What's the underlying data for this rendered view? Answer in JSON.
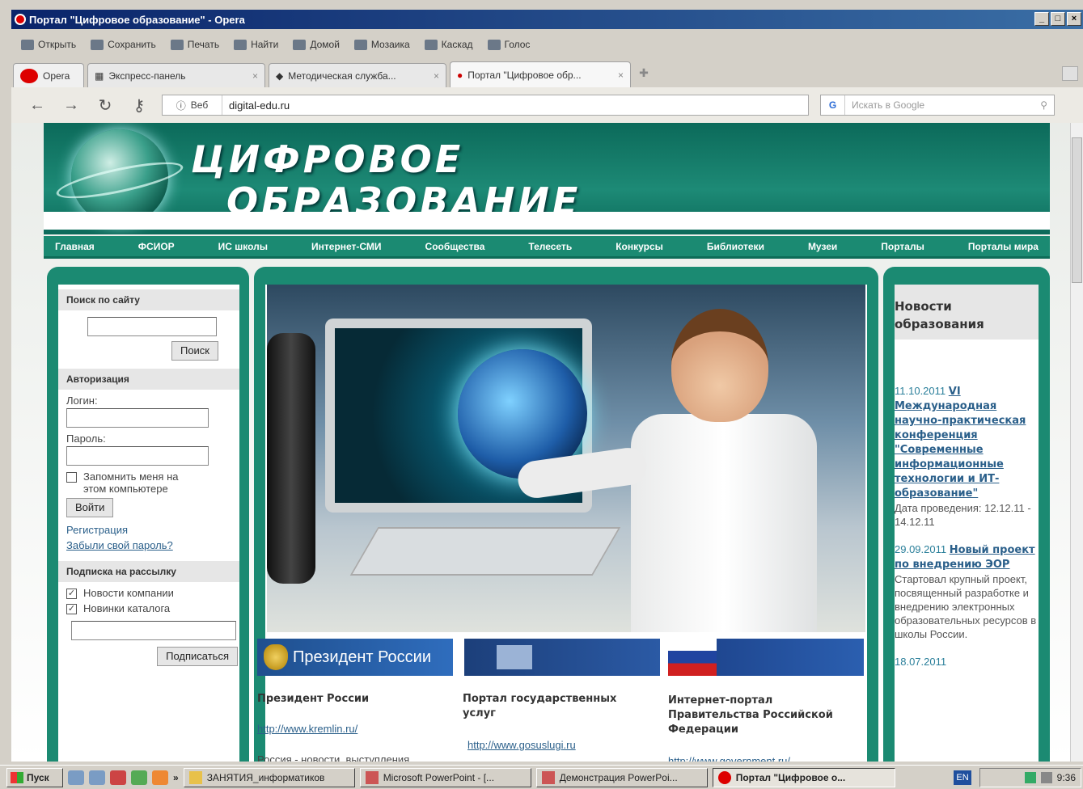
{
  "window": {
    "title": "Портал \"Цифровое образование\" - Opera",
    "minimize": "_",
    "maximize": "□",
    "close": "×"
  },
  "menu": [
    "Открыть",
    "Сохранить",
    "Печать",
    "Найти",
    "Домой",
    "Мозаика",
    "Каскад",
    "Голос"
  ],
  "tabs": {
    "opera_label": "Opera",
    "items": [
      {
        "label": "Экспресс-панель"
      },
      {
        "label": "Методическая служба..."
      },
      {
        "label": "Портал \"Цифровое обр..."
      }
    ],
    "close": "×"
  },
  "address": {
    "zone": "Веб",
    "url": "digital-edu.ru"
  },
  "search": {
    "engine": "G",
    "placeholder": "Искать в Google"
  },
  "site": {
    "title_line1": "ЦИФРОВОЕ",
    "title_line2": "ОБРАЗОВАНИЕ",
    "nav": [
      "Главная",
      "ФСИОР",
      "ИС школы",
      "Интернет-СМИ",
      "Сообщества",
      "Телесеть",
      "Конкурсы",
      "Библиотеки",
      "Музеи",
      "Порталы",
      "Порталы мира"
    ]
  },
  "left": {
    "search_head": "Поиск по сайту",
    "search_button": "Поиск",
    "auth_head": "Авторизация",
    "login_label": "Логин:",
    "password_label": "Пароль:",
    "remember_line1": "Запомнить меня на",
    "remember_line2": "этом компьютере",
    "login_button": "Войти",
    "register": "Регистрация",
    "forgot": "Забыли свой пароль?",
    "subscribe_head": "Подписка на рассылку",
    "sub_news": "Новости компании",
    "sub_catalog": "Новинки каталога",
    "subscribe_button": "Подписаться"
  },
  "middle": {
    "banners": [
      "Президент России",
      "",
      ""
    ],
    "cards": [
      {
        "title": "Президент России",
        "link": "http://www.kremlin.ru/",
        "text": "Россия - новости, выступления"
      },
      {
        "title": "Портал государственных услуг",
        "link": "http://www.gosuslugi.ru",
        "text": ""
      },
      {
        "title": "Интернет-портал Правительства Российской Федерации",
        "link": "http://www.government.ru/",
        "text": ""
      }
    ]
  },
  "right": {
    "head_line1": "Новости",
    "head_line2": "образования",
    "news": [
      {
        "date": "11.10.2011",
        "title": "VI Международная научно-практическая конференция \"Современные информационные технологии и ИТ-образование\"",
        "body": "Дата проведения: 12.12.11 - 14.12.11"
      },
      {
        "date": "29.09.2011",
        "title": "Новый проект по внедрению ЭОР",
        "body": "Стартовал крупный проект, посвященный разработке и внедрению электронных образовательных ресурсов в школы России."
      },
      {
        "date": "18.07.2011",
        "title": "",
        "body": ""
      }
    ]
  },
  "taskbar": {
    "start": "Пуск",
    "tasks": [
      "ЗАНЯТИЯ_информатиков",
      "Microsoft PowerPoint - [...",
      "Демонстрация PowerPoi...",
      "Портал \"Цифровое о..."
    ],
    "lang": "EN",
    "clock": "9:36"
  }
}
